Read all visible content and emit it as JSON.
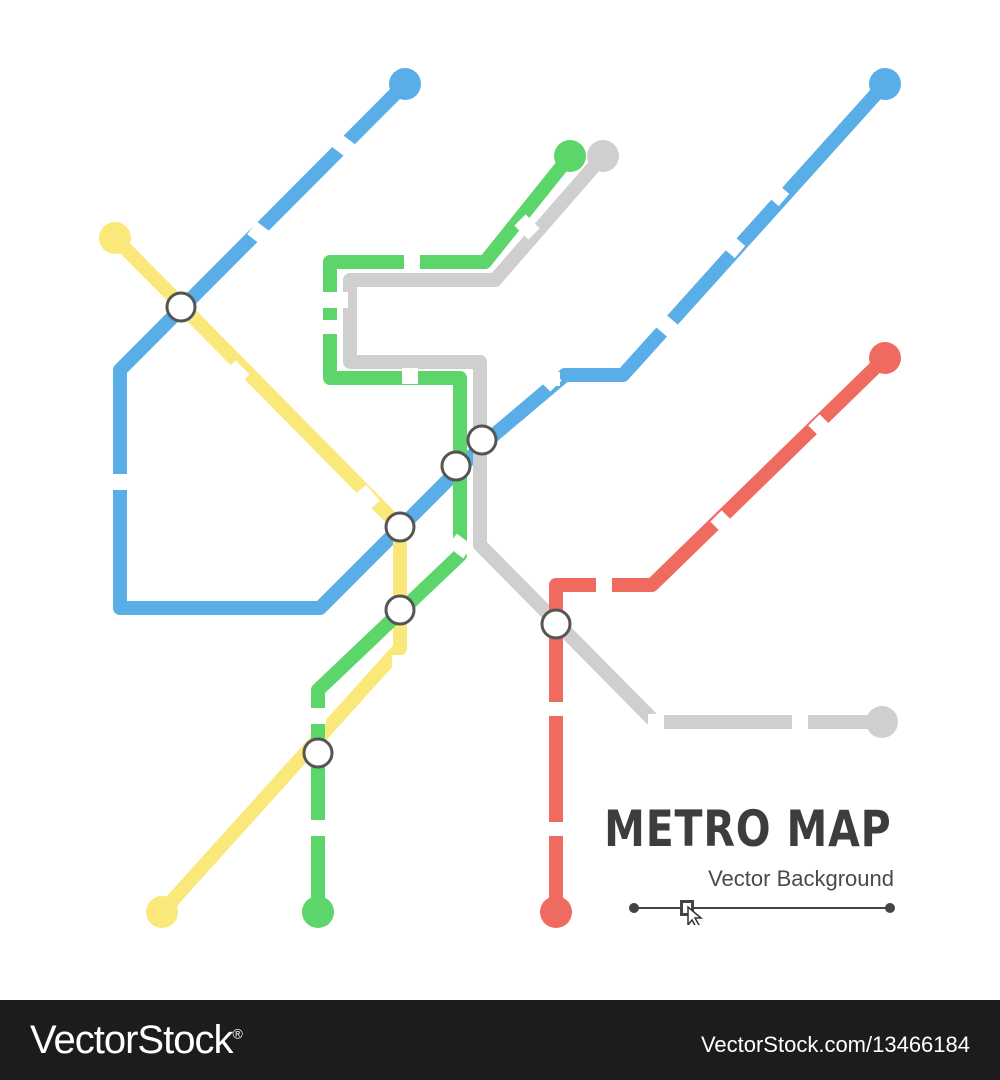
{
  "title": "METRO MAP",
  "subtitle": "Vector Background",
  "footer": {
    "brand": "VectorStock",
    "registered_mark": "®",
    "image_id": "VectorStock.com/13466184"
  },
  "colors": {
    "blue": "#5aaee8",
    "yellow": "#fbe87a",
    "green": "#5cd56a",
    "gray": "#cfcfcf",
    "red": "#ef6b60",
    "station_stroke": "#555555",
    "text": "#3d3d3d",
    "footer_bg": "#1c1c1c"
  },
  "lines": [
    {
      "name": "blue-line-a",
      "color": "blue"
    },
    {
      "name": "blue-line-b",
      "color": "blue"
    },
    {
      "name": "yellow-line",
      "color": "yellow"
    },
    {
      "name": "green-line",
      "color": "green"
    },
    {
      "name": "gray-line",
      "color": "gray"
    },
    {
      "name": "red-line",
      "color": "red"
    }
  ],
  "stations": [
    "interchange-1",
    "interchange-2",
    "interchange-3",
    "interchange-4",
    "interchange-5",
    "interchange-6",
    "interchange-7"
  ],
  "icons": [
    "slider-handle-icon",
    "cursor-arrow-icon"
  ]
}
